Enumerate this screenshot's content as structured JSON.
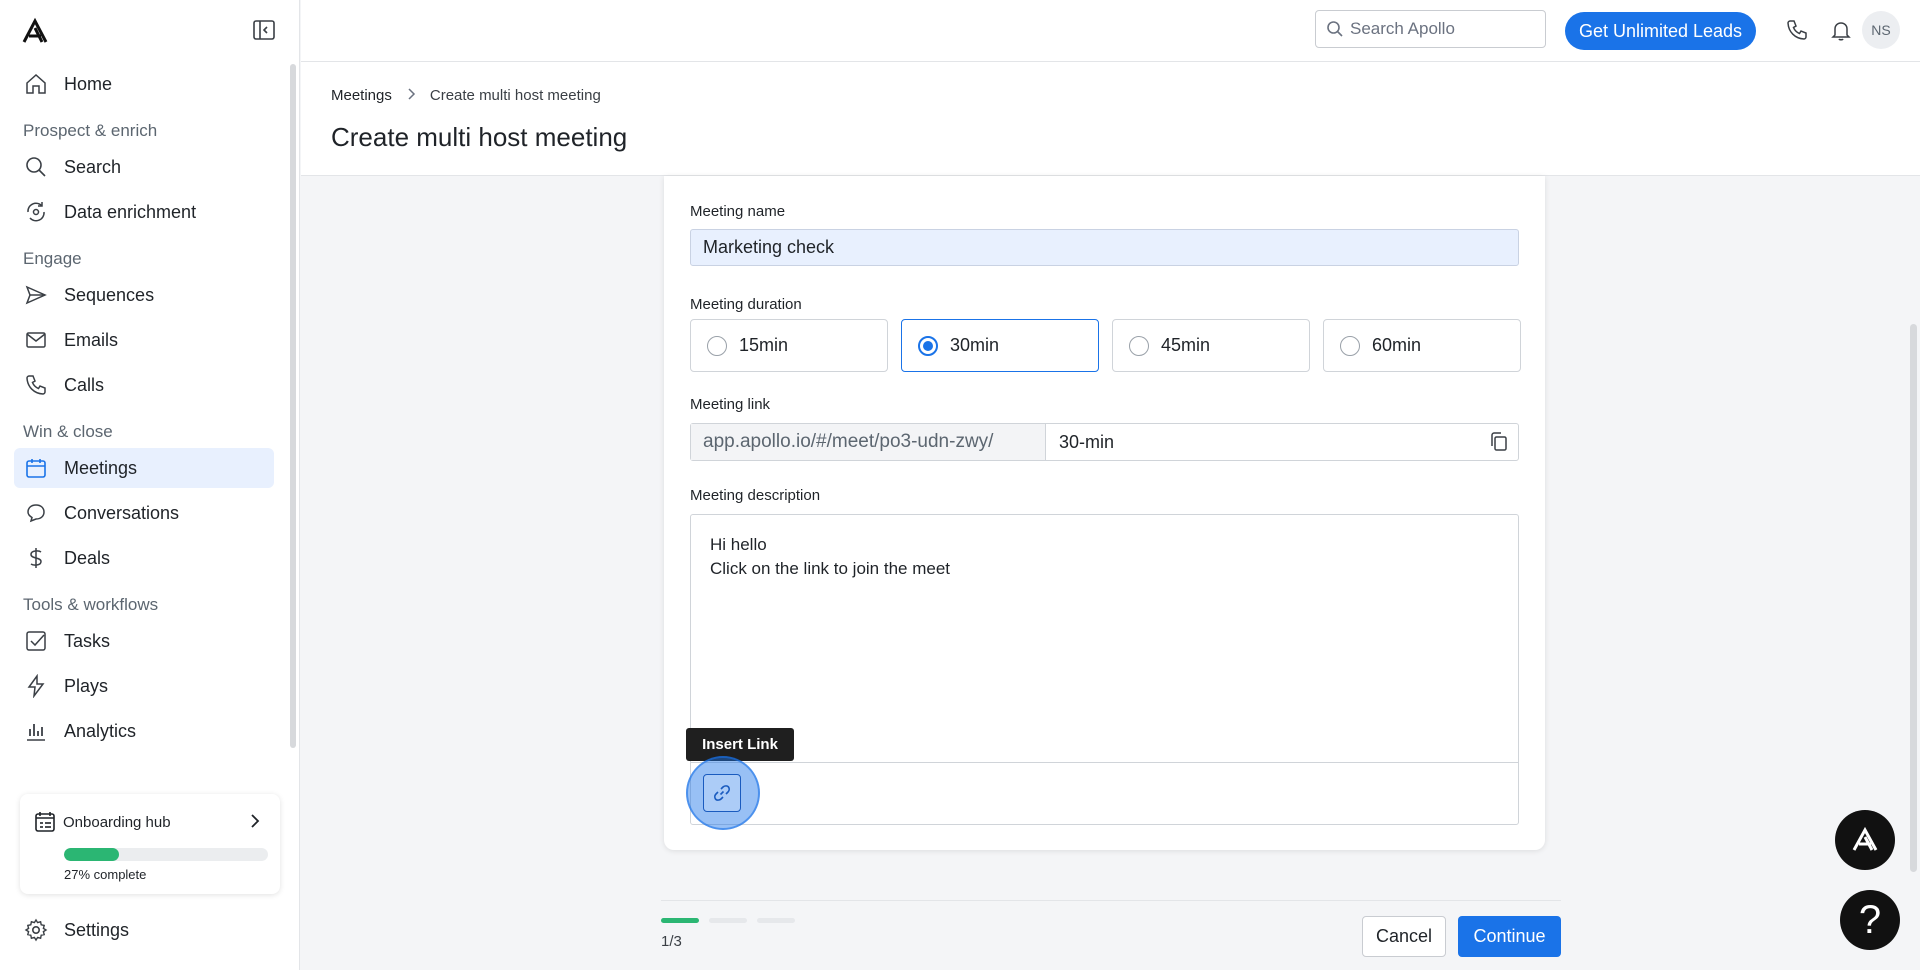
{
  "sidebar": {
    "items": [
      {
        "type": "item",
        "label": "Home",
        "icon": "home-icon"
      },
      {
        "type": "section",
        "label": "Prospect & enrich"
      },
      {
        "type": "item",
        "label": "Search",
        "icon": "search-icon"
      },
      {
        "type": "item",
        "label": "Data enrichment",
        "icon": "refresh-icon"
      },
      {
        "type": "section",
        "label": "Engage"
      },
      {
        "type": "item",
        "label": "Sequences",
        "icon": "send-icon"
      },
      {
        "type": "item",
        "label": "Emails",
        "icon": "mail-icon"
      },
      {
        "type": "item",
        "label": "Calls",
        "icon": "phone-icon"
      },
      {
        "type": "section",
        "label": "Win & close"
      },
      {
        "type": "item",
        "label": "Meetings",
        "icon": "calendar-icon",
        "active": true
      },
      {
        "type": "item",
        "label": "Conversations",
        "icon": "chat-icon"
      },
      {
        "type": "item",
        "label": "Deals",
        "icon": "dollar-icon"
      },
      {
        "type": "section",
        "label": "Tools & workflows"
      },
      {
        "type": "item",
        "label": "Tasks",
        "icon": "checkbox-icon"
      },
      {
        "type": "item",
        "label": "Plays",
        "icon": "bolt-icon"
      },
      {
        "type": "item",
        "label": "Analytics",
        "icon": "chart-icon"
      }
    ],
    "onboarding": {
      "title": "Onboarding hub",
      "progress_pct": 27,
      "progress_label": "27% complete"
    },
    "settings_label": "Settings"
  },
  "topbar": {
    "search_placeholder": "Search Apollo",
    "cta_label": "Get Unlimited Leads",
    "avatar_initials": "NS"
  },
  "header": {
    "breadcrumb_root": "Meetings",
    "breadcrumb_current": "Create multi host meeting",
    "title": "Create multi host meeting"
  },
  "form": {
    "name_label": "Meeting name",
    "name_value": "Marketing check",
    "duration_label": "Meeting duration",
    "durations": [
      "15min",
      "30min",
      "45min",
      "60min"
    ],
    "selected_duration": "30min",
    "link_label": "Meeting link",
    "link_prefix": "app.apollo.io/#/meet/po3-udn-zwy/",
    "link_slug": "30-min",
    "description_label": "Meeting description",
    "description_lines": [
      "Hi hello",
      "Click on the link to join the meet"
    ],
    "tooltip": "Insert Link"
  },
  "footer": {
    "step_label": "1/3",
    "current_step": 1,
    "total_steps": 3,
    "cancel_label": "Cancel",
    "continue_label": "Continue"
  },
  "colors": {
    "accent": "#1a73e8",
    "progress": "#2bb673",
    "active_nav_bg": "#e8f0fe"
  }
}
